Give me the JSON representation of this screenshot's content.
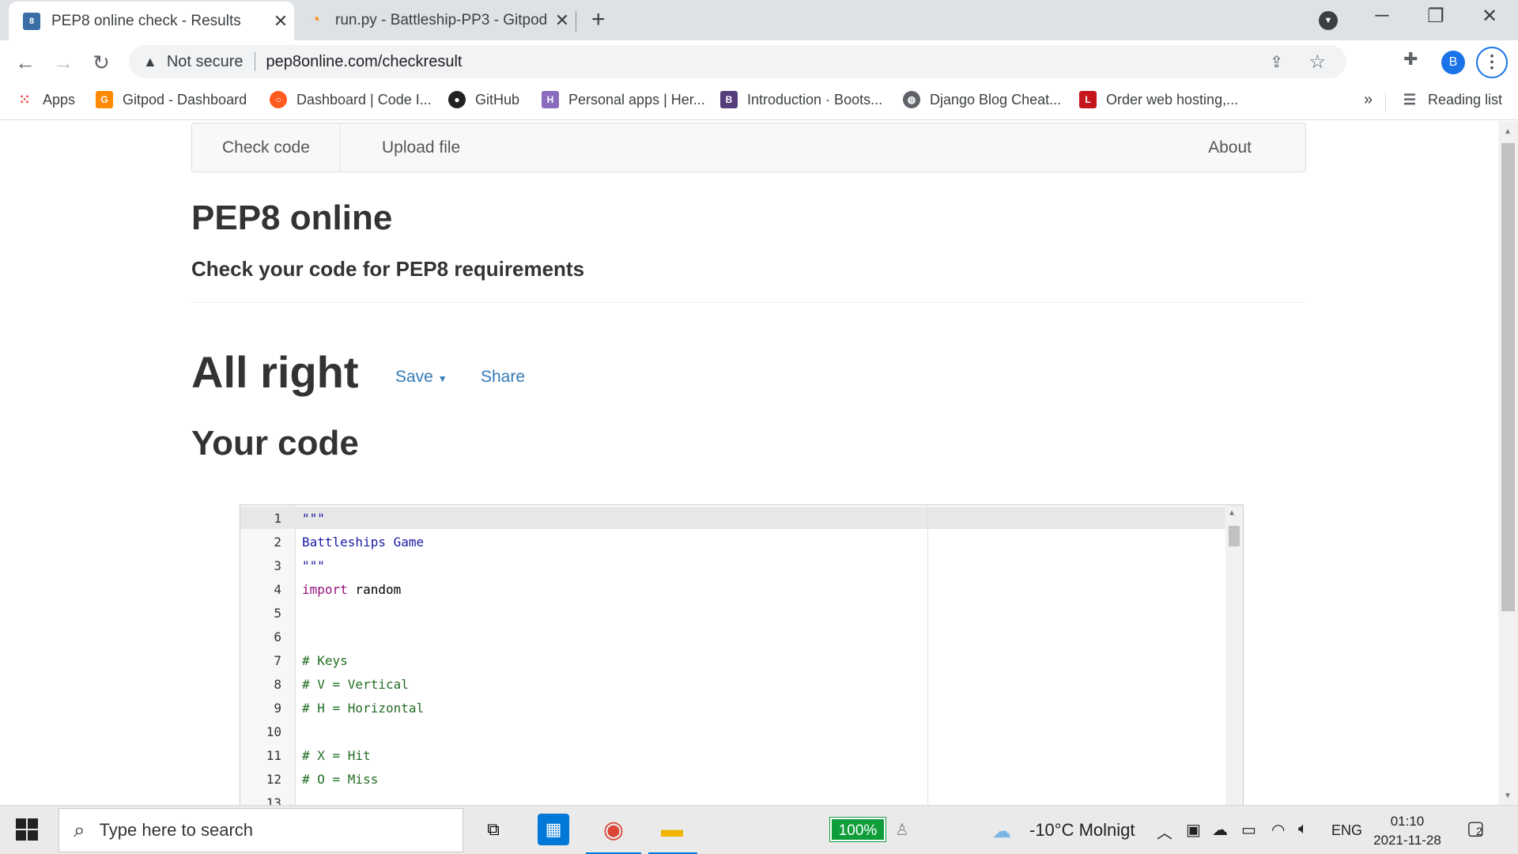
{
  "browser": {
    "tabs": [
      {
        "title": "PEP8 online check - Results",
        "active": true
      },
      {
        "title": "run.py - Battleship-PP3 - Gitpod",
        "active": false
      }
    ],
    "new_tab": "+",
    "address": {
      "security_label": "Not secure",
      "url": "pep8online.com/checkresult"
    },
    "profile_initial": "B",
    "bookmarks": [
      {
        "label": "Apps",
        "icon": "apps-grid-icon"
      },
      {
        "label": "Gitpod - Dashboard",
        "icon": "gitpod-icon"
      },
      {
        "label": "Dashboard | Code I...",
        "icon": "code-institute-icon"
      },
      {
        "label": "GitHub",
        "icon": "github-icon"
      },
      {
        "label": "Personal apps | Her...",
        "icon": "heroku-icon"
      },
      {
        "label": "Introduction · Boots...",
        "icon": "bootstrap-icon"
      },
      {
        "label": "Django Blog Cheat...",
        "icon": "globe-icon"
      },
      {
        "label": "Order web hosting,...",
        "icon": "hosting-icon"
      }
    ],
    "more_bookmarks": "»",
    "reading_list": "Reading list"
  },
  "site": {
    "nav": {
      "check_code": "Check code",
      "upload_file": "Upload file",
      "about": "About"
    },
    "title": "PEP8 online",
    "tagline": "Check your code for PEP8 requirements",
    "result_heading": "All right",
    "save_label": "Save",
    "share_label": "Share",
    "code_heading": "Your code"
  },
  "code_lines": [
    {
      "n": "1",
      "text": "\"\"\"",
      "kind": "str"
    },
    {
      "n": "2",
      "text": "Battleships Game",
      "kind": "str"
    },
    {
      "n": "3",
      "text": "\"\"\"",
      "kind": "str"
    },
    {
      "n": "4",
      "kw": "import",
      "text": " random",
      "kind": "import"
    },
    {
      "n": "5",
      "text": "",
      "kind": "plain"
    },
    {
      "n": "6",
      "text": "",
      "kind": "plain"
    },
    {
      "n": "7",
      "text": "# Keys",
      "kind": "cmt"
    },
    {
      "n": "8",
      "text": "# V = Vertical",
      "kind": "cmt"
    },
    {
      "n": "9",
      "text": "# H = Horizontal",
      "kind": "cmt"
    },
    {
      "n": "10",
      "text": "",
      "kind": "plain"
    },
    {
      "n": "11",
      "text": "# X = Hit",
      "kind": "cmt"
    },
    {
      "n": "12",
      "text": "# O = Miss",
      "kind": "cmt"
    },
    {
      "n": "13",
      "text": "",
      "kind": "plain"
    }
  ],
  "taskbar": {
    "search_placeholder": "Type here to search",
    "battery_percent": "100%",
    "weather": "-10°C  Molnigt",
    "language": "ENG",
    "time": "01:10",
    "date": "2021-11-28",
    "notifications": "2"
  },
  "colors": {
    "link": "#337ab7",
    "string": "#1a1aa6",
    "keyword": "#93127c",
    "comment": "#236e24",
    "profile": "#1a73e8"
  }
}
